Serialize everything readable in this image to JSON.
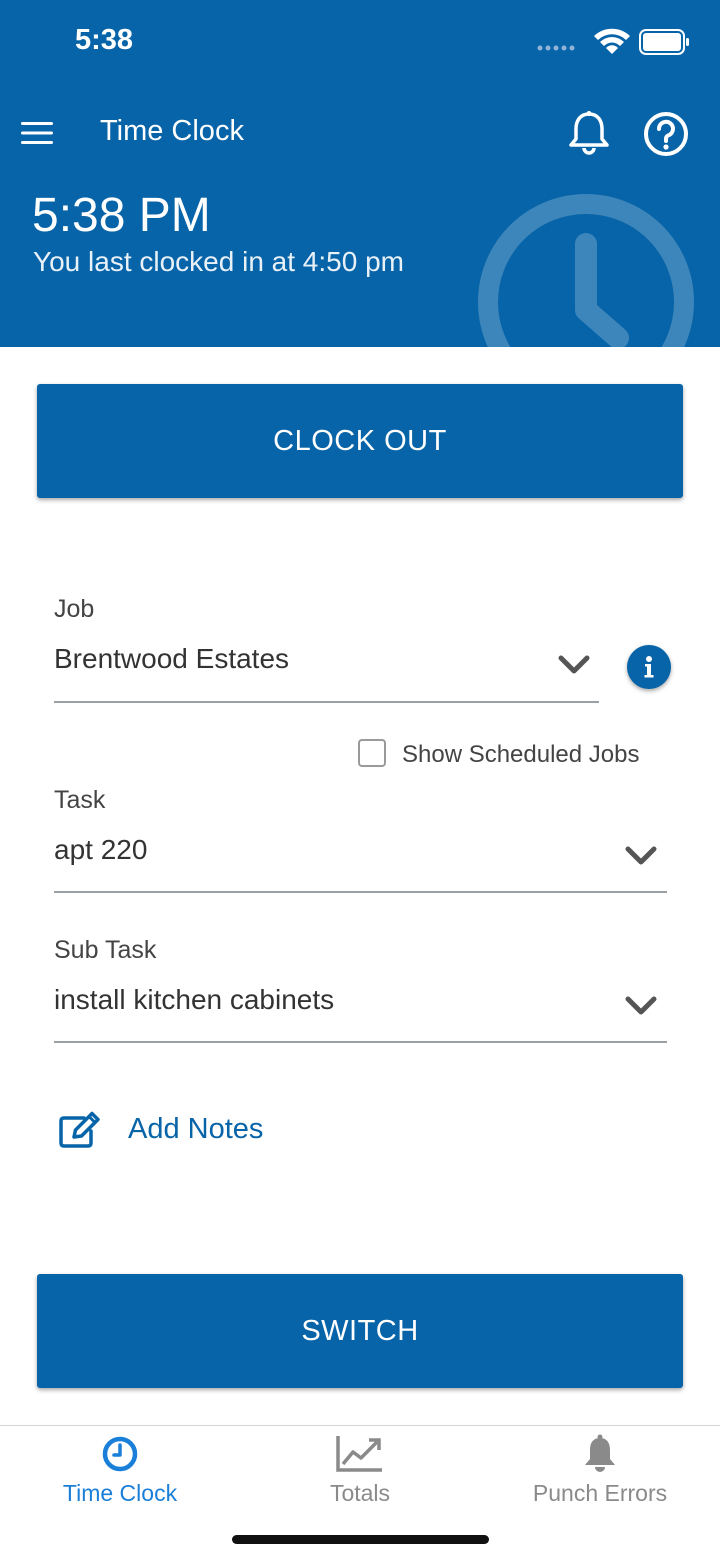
{
  "status_bar": {
    "time": "5:38"
  },
  "header": {
    "title": "Time Clock",
    "current_time": "5:38 PM",
    "last_clocked": "You last clocked in at 4:50 pm"
  },
  "actions": {
    "clock_out": "CLOCK OUT",
    "switch": "SWITCH"
  },
  "form": {
    "job": {
      "label": "Job",
      "value": "Brentwood Estates"
    },
    "show_scheduled_jobs": {
      "label": "Show Scheduled Jobs",
      "checked": false
    },
    "task": {
      "label": "Task",
      "value": "apt 220"
    },
    "sub_task": {
      "label": "Sub Task",
      "value": "install kitchen cabinets"
    },
    "add_notes": "Add Notes"
  },
  "tabs": [
    {
      "label": "Time Clock",
      "icon": "clock-icon",
      "active": true
    },
    {
      "label": "Totals",
      "icon": "line-chart-icon",
      "active": false
    },
    {
      "label": "Punch Errors",
      "icon": "bell-icon",
      "active": false
    }
  ],
  "colors": {
    "primary": "#0764a8",
    "tab_active": "#1a7fd8",
    "tab_inactive": "#8a8a8a"
  }
}
